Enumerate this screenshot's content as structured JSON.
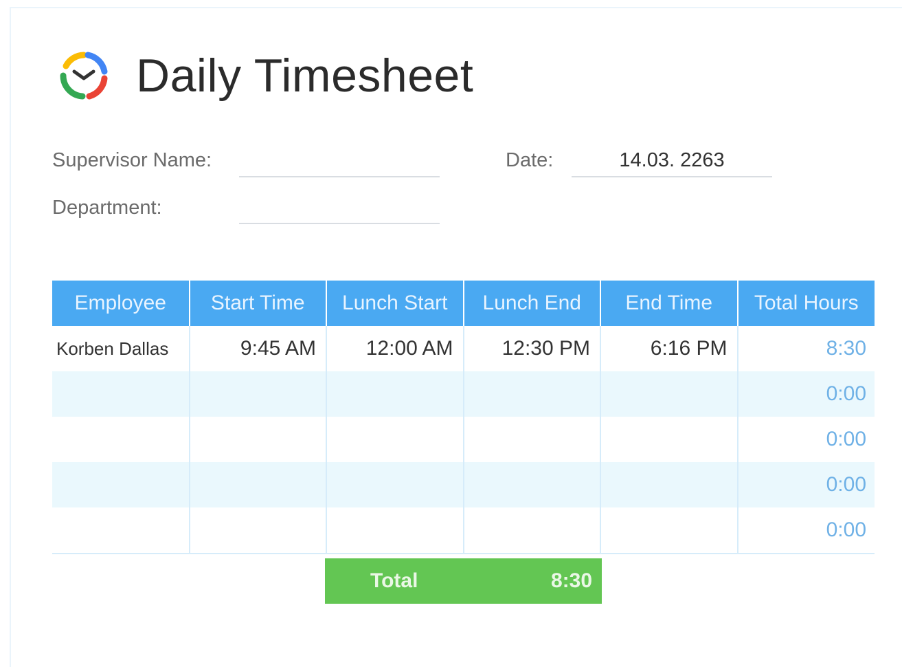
{
  "header": {
    "title": "Daily Timesheet",
    "logo_icon": "clock-logo-icon",
    "logo_colors": [
      "#4285f4",
      "#ea4335",
      "#fbbc05",
      "#34a853"
    ]
  },
  "form": {
    "supervisor_label": "Supervisor Name:",
    "supervisor_value": "",
    "department_label": "Department:",
    "department_value": "",
    "date_label": "Date:",
    "date_value": "14.03. 2263"
  },
  "table": {
    "columns": [
      "Employee",
      "Start Time",
      "Lunch Start",
      "Lunch End",
      "End Time",
      "Total Hours"
    ],
    "header_color": "#4aa9f2",
    "rows": [
      {
        "employee": "Korben Dallas",
        "start": "9:45 AM",
        "lunch_start": "12:00 AM",
        "lunch_end": "12:30 PM",
        "end": "6:16 PM",
        "total": "8:30"
      },
      {
        "employee": "",
        "start": "",
        "lunch_start": "",
        "lunch_end": "",
        "end": "",
        "total": "0:00"
      },
      {
        "employee": "",
        "start": "",
        "lunch_start": "",
        "lunch_end": "",
        "end": "",
        "total": "0:00"
      },
      {
        "employee": "",
        "start": "",
        "lunch_start": "",
        "lunch_end": "",
        "end": "",
        "total": "0:00"
      },
      {
        "employee": "",
        "start": "",
        "lunch_start": "",
        "lunch_end": "",
        "end": "",
        "total": "0:00"
      }
    ]
  },
  "summary": {
    "label": "Total",
    "value": "8:30",
    "color": "#63c653"
  }
}
